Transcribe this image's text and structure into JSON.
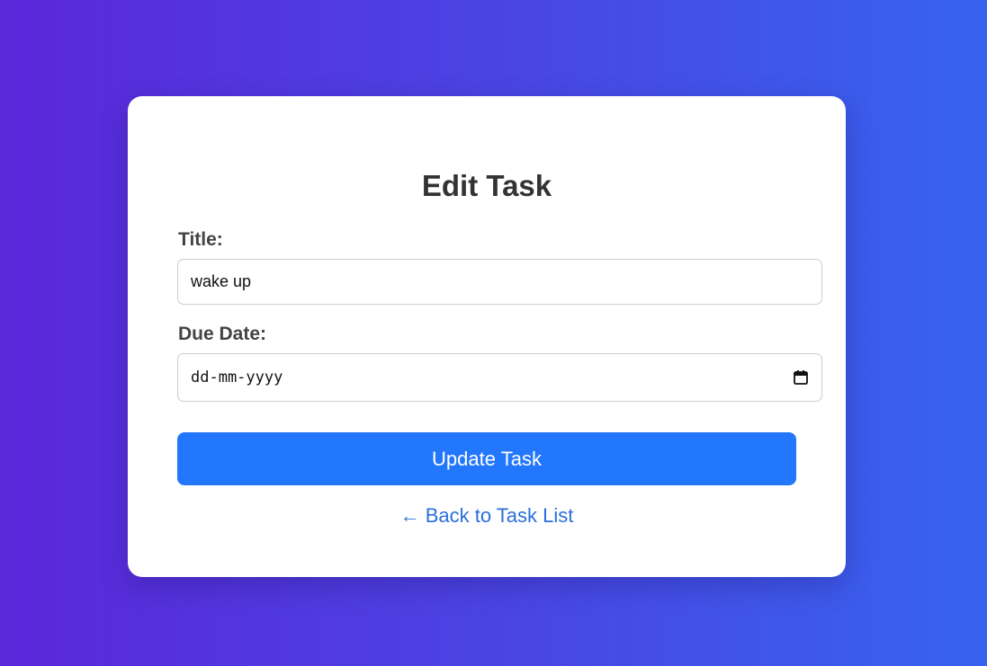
{
  "form": {
    "heading": "Edit Task",
    "title_label": "Title:",
    "title_value": "wake up",
    "due_date_label": "Due Date:",
    "due_date_placeholder": "dd-mm-yyyy",
    "update_button_label": "Update Task",
    "back_link_arrow": "←",
    "back_link_label": "Back to Task List"
  },
  "colors": {
    "background_start": "#5b27d9",
    "background_end": "#3763ef",
    "card": "#ffffff",
    "primary_button": "#2377fc",
    "link": "#2a6fdb",
    "heading_text": "#333333"
  },
  "icons": {
    "date_picker": "calendar-icon",
    "back_arrow": "left-arrow"
  }
}
